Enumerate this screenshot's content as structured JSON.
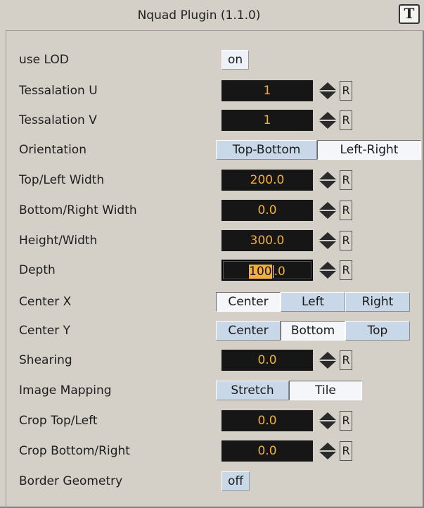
{
  "window": {
    "title": "Nquad Plugin (1.1.0)",
    "icon": "plugin-info-icon"
  },
  "rows": {
    "use_lod": {
      "label": "use LOD",
      "value": "on"
    },
    "tess_u": {
      "label": "Tessalation U",
      "value": "1",
      "reset": "R"
    },
    "tess_v": {
      "label": "Tessalation V",
      "value": "1",
      "reset": "R"
    },
    "orientation": {
      "label": "Orientation",
      "options": [
        "Top-Bottom",
        "Left-Right"
      ],
      "selected": "Left-Right"
    },
    "top_left_width": {
      "label": "Top/Left Width",
      "value": "200.0",
      "reset": "R"
    },
    "bottom_right_width": {
      "label": "Bottom/Right Width",
      "value": "0.0",
      "reset": "R"
    },
    "height_width": {
      "label": "Height/Width",
      "value": "300.0",
      "reset": "R"
    },
    "depth": {
      "label": "Depth",
      "value_selected": "100",
      "value_rest": ".0",
      "reset": "R"
    },
    "center_x": {
      "label": "Center X",
      "options": [
        "Center",
        "Left",
        "Right"
      ],
      "selected": "Center"
    },
    "center_y": {
      "label": "Center Y",
      "options": [
        "Center",
        "Bottom",
        "Top"
      ],
      "selected": "Bottom"
    },
    "shearing": {
      "label": "Shearing",
      "value": "0.0",
      "reset": "R"
    },
    "image_mapping": {
      "label": "Image Mapping",
      "options": [
        "Stretch",
        "Tile"
      ],
      "selected": "Tile"
    },
    "crop_top_left": {
      "label": "Crop Top/Left",
      "value": "0.0",
      "reset": "R"
    },
    "crop_bottom_right": {
      "label": "Crop Bottom/Right",
      "value": "0.0",
      "reset": "R"
    },
    "border_geometry": {
      "label": "Border Geometry",
      "value": "off"
    }
  },
  "colors": {
    "panel_bg": "#d4d0c8",
    "field_bg": "#161616",
    "field_text": "#f2b13a",
    "segment_bg": "#c8d8e8",
    "segment_selected_bg": "#f4f6fa"
  }
}
